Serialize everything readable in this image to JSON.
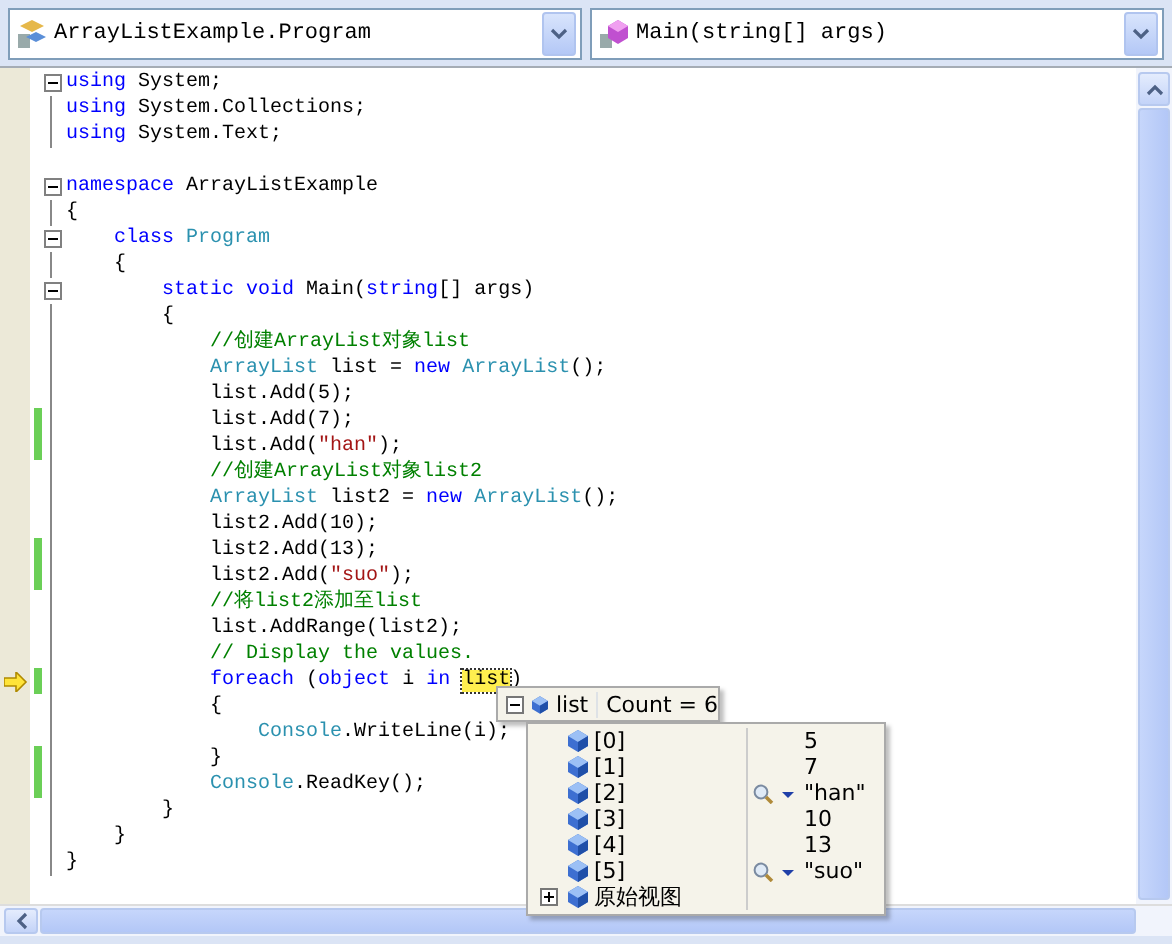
{
  "editor": {
    "type_dropdown": {
      "text": "ArrayListExample.Program"
    },
    "member_dropdown": {
      "text": "Main(string[] args)"
    },
    "lines": [
      {
        "fold": true,
        "changed": false,
        "current": false,
        "segments": [
          {
            "kind": "keyword",
            "text": "using"
          },
          {
            "kind": "plain",
            "text": " System;"
          }
        ]
      },
      {
        "fold": false,
        "changed": false,
        "current": false,
        "segments": [
          {
            "kind": "keyword",
            "text": "using"
          },
          {
            "kind": "plain",
            "text": " System.Collections;"
          }
        ]
      },
      {
        "fold": false,
        "changed": false,
        "current": false,
        "segments": [
          {
            "kind": "keyword",
            "text": "using"
          },
          {
            "kind": "plain",
            "text": " System.Text;"
          }
        ]
      },
      {
        "fold": false,
        "changed": false,
        "current": false
      },
      {
        "fold": true,
        "changed": false,
        "current": false,
        "segments": [
          {
            "kind": "keyword",
            "text": "namespace"
          },
          {
            "kind": "plain",
            "text": " ArrayListExample"
          }
        ]
      },
      {
        "fold": false,
        "changed": false,
        "current": false,
        "segments": [
          {
            "kind": "plain",
            "text": "{"
          }
        ]
      },
      {
        "fold": true,
        "changed": false,
        "current": false,
        "segments": [
          {
            "kind": "keyword",
            "text": "    class"
          },
          {
            "kind": "type",
            "text": " Program"
          }
        ]
      },
      {
        "fold": false,
        "changed": false,
        "current": false,
        "segments": [
          {
            "kind": "plain",
            "text": "    {"
          }
        ]
      },
      {
        "fold": true,
        "changed": false,
        "current": false,
        "segments": [
          {
            "kind": "keyword",
            "text": "        static void"
          },
          {
            "kind": "plain",
            "text": " Main("
          },
          {
            "kind": "keyword",
            "text": "string"
          },
          {
            "kind": "plain",
            "text": "[] args)"
          }
        ]
      },
      {
        "fold": false,
        "changed": false,
        "current": false,
        "segments": [
          {
            "kind": "plain",
            "text": "        {"
          }
        ]
      },
      {
        "fold": false,
        "changed": false,
        "current": false,
        "segments": [
          {
            "kind": "comment",
            "text": "            //创建ArrayList对象list"
          }
        ]
      },
      {
        "fold": false,
        "changed": false,
        "current": false,
        "segments": [
          {
            "kind": "type",
            "text": "            ArrayList"
          },
          {
            "kind": "plain",
            "text": " list ="
          },
          {
            "kind": "keyword",
            "text": " new"
          },
          {
            "kind": "type",
            "text": " ArrayList"
          },
          {
            "kind": "plain",
            "text": "();"
          }
        ]
      },
      {
        "fold": false,
        "changed": false,
        "current": false,
        "segments": [
          {
            "kind": "plain",
            "text": "            list.Add(5);"
          }
        ]
      },
      {
        "fold": false,
        "changed": true,
        "current": false,
        "segments": [
          {
            "kind": "plain",
            "text": "            list.Add(7);"
          }
        ]
      },
      {
        "fold": false,
        "changed": true,
        "current": false,
        "segments": [
          {
            "kind": "plain",
            "text": "            list.Add("
          },
          {
            "kind": "string",
            "text": "\"han\""
          },
          {
            "kind": "plain",
            "text": ");"
          }
        ]
      },
      {
        "fold": false,
        "changed": false,
        "current": false,
        "segments": [
          {
            "kind": "comment",
            "text": "            //创建ArrayList对象list2"
          }
        ]
      },
      {
        "fold": false,
        "changed": false,
        "current": false,
        "segments": [
          {
            "kind": "type",
            "text": "            ArrayList"
          },
          {
            "kind": "plain",
            "text": " list2 ="
          },
          {
            "kind": "keyword",
            "text": " new"
          },
          {
            "kind": "type",
            "text": " ArrayList"
          },
          {
            "kind": "plain",
            "text": "();"
          }
        ]
      },
      {
        "fold": false,
        "changed": false,
        "current": false,
        "segments": [
          {
            "kind": "plain",
            "text": "            list2.Add(10);"
          }
        ]
      },
      {
        "fold": false,
        "changed": true,
        "current": false,
        "segments": [
          {
            "kind": "plain",
            "text": "            list2.Add(13);"
          }
        ]
      },
      {
        "fold": false,
        "changed": true,
        "current": false,
        "segments": [
          {
            "kind": "plain",
            "text": "            list2.Add("
          },
          {
            "kind": "string",
            "text": "\"suo\""
          },
          {
            "kind": "plain",
            "text": ");"
          }
        ]
      },
      {
        "fold": false,
        "changed": false,
        "current": false,
        "segments": [
          {
            "kind": "comment",
            "text": "            //将list2添加至list"
          }
        ]
      },
      {
        "fold": false,
        "changed": false,
        "current": false,
        "segments": [
          {
            "kind": "plain",
            "text": "            list.AddRange(list2);"
          }
        ]
      },
      {
        "fold": false,
        "changed": false,
        "current": false,
        "segments": [
          {
            "kind": "comment",
            "text": "            // Display the values."
          }
        ]
      },
      {
        "fold": false,
        "changed": true,
        "current": true,
        "segments": [
          {
            "kind": "keyword",
            "text": "            foreach"
          },
          {
            "kind": "plain",
            "text": " ("
          },
          {
            "kind": "keyword",
            "text": "object"
          },
          {
            "kind": "plain",
            "text": " i"
          },
          {
            "kind": "keyword",
            "text": " in "
          },
          {
            "kind": "highlight",
            "text": "list"
          },
          {
            "kind": "plain",
            "text": ")"
          }
        ]
      },
      {
        "fold": false,
        "changed": false,
        "current": false,
        "segments": [
          {
            "kind": "plain",
            "text": "            {"
          }
        ]
      },
      {
        "fold": false,
        "changed": false,
        "current": false,
        "segments": [
          {
            "kind": "type",
            "text": "                Console"
          },
          {
            "kind": "plain",
            "text": ".WriteLine(i);"
          }
        ]
      },
      {
        "fold": false,
        "changed": true,
        "current": false,
        "segments": [
          {
            "kind": "plain",
            "text": "            }"
          }
        ]
      },
      {
        "fold": false,
        "changed": true,
        "current": false,
        "segments": [
          {
            "kind": "type",
            "text": "            Console"
          },
          {
            "kind": "plain",
            "text": ".ReadKey();"
          }
        ]
      },
      {
        "fold": false,
        "changed": false,
        "current": false,
        "segments": [
          {
            "kind": "plain",
            "text": "        }"
          }
        ]
      },
      {
        "fold": false,
        "changed": false,
        "current": false,
        "segments": [
          {
            "kind": "plain",
            "text": "    }"
          }
        ]
      },
      {
        "fold": false,
        "changed": false,
        "current": false,
        "segments": [
          {
            "kind": "plain",
            "text": "}"
          }
        ]
      }
    ]
  },
  "datatip": {
    "expanded": true,
    "name": "list",
    "value": "Count = 6",
    "items": [
      {
        "name": "[0]",
        "value": "5",
        "visualizer": false
      },
      {
        "name": "[1]",
        "value": "7",
        "visualizer": false
      },
      {
        "name": "[2]",
        "value": "\"han\"",
        "visualizer": true
      },
      {
        "name": "[3]",
        "value": "10",
        "visualizer": false
      },
      {
        "name": "[4]",
        "value": "13",
        "visualizer": false
      },
      {
        "name": "[5]",
        "value": "\"suo\"",
        "visualizer": true
      },
      {
        "name": "原始视图",
        "expanded": false,
        "visualizer": false
      }
    ]
  }
}
